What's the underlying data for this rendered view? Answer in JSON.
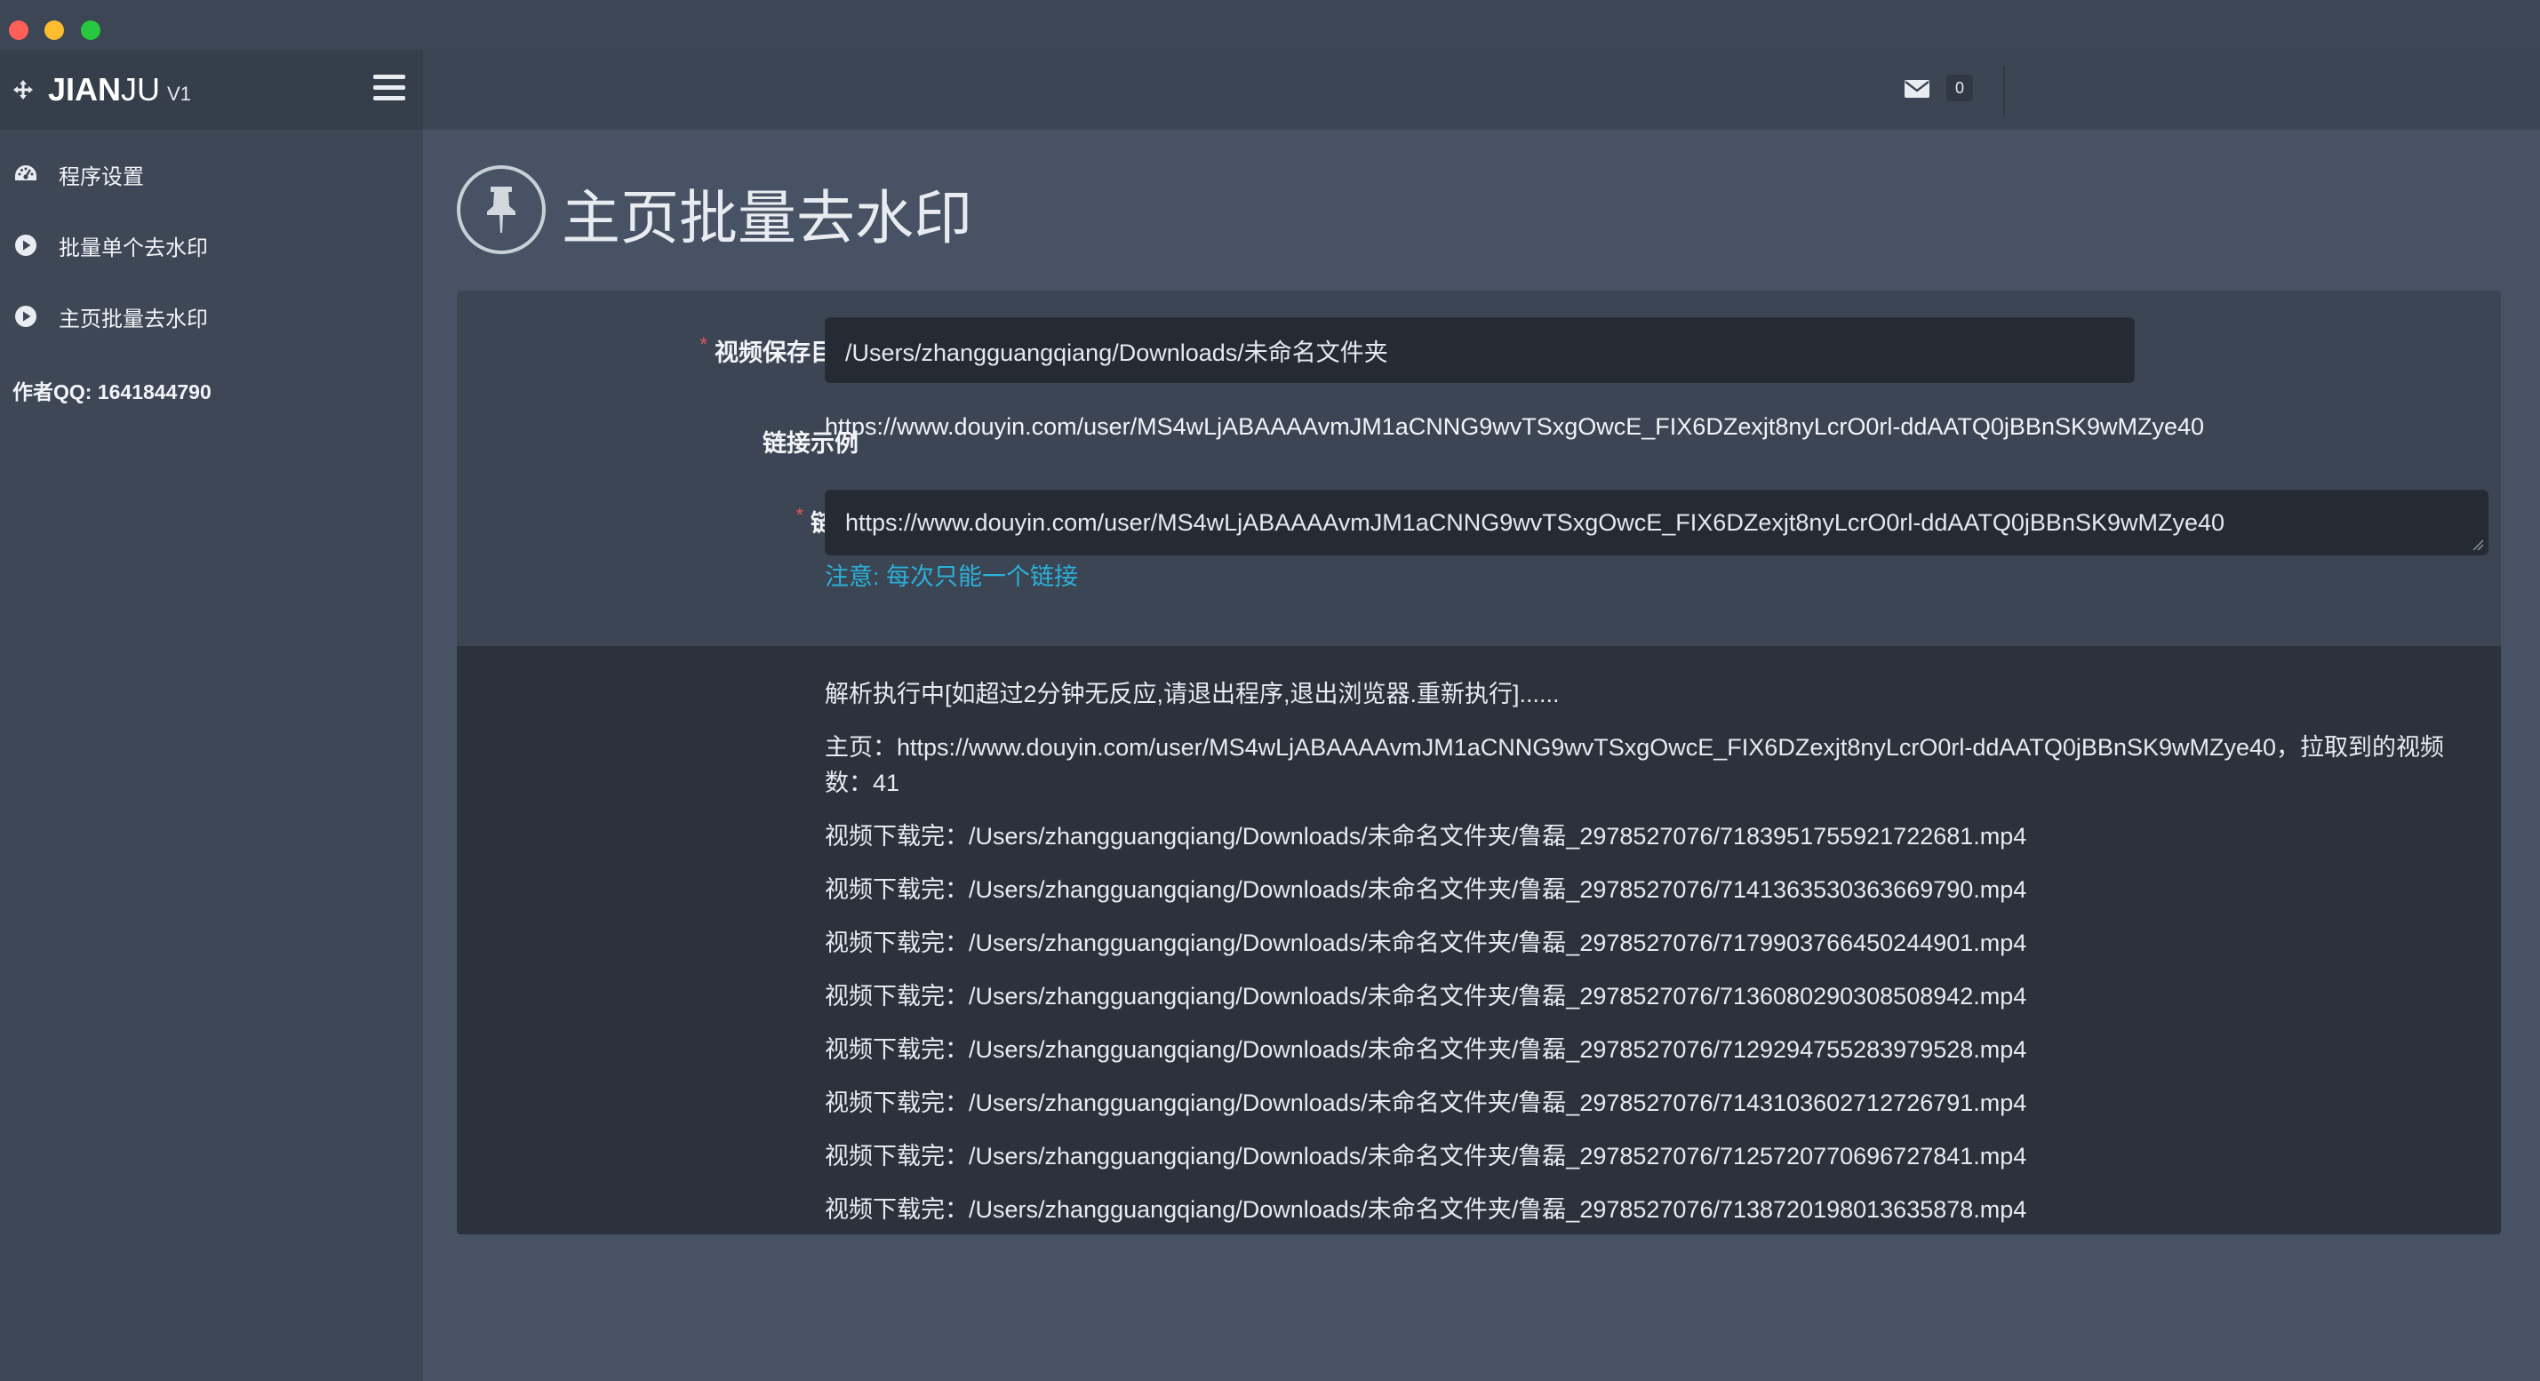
{
  "window": {
    "buttons": [
      "close",
      "minimize",
      "maximize"
    ]
  },
  "brand": {
    "name_bold": "JIAN",
    "name_light": "JU",
    "version": "V1",
    "icon": "arrows-icon"
  },
  "sidebar": {
    "items": [
      {
        "label": "程序设置",
        "icon": "dashboard-icon"
      },
      {
        "label": "批量单个去水印",
        "icon": "play-circle-icon"
      },
      {
        "label": "主页批量去水印",
        "icon": "play-circle-icon"
      }
    ],
    "author": "作者QQ: 1641844790"
  },
  "topbar": {
    "mail_count": "0"
  },
  "page": {
    "title": "主页批量去水印",
    "icon": "pushpin-icon"
  },
  "form": {
    "save_dir_label": "视频保存目录",
    "save_dir_value": "/Users/zhangguangqiang/Downloads/未命名文件夹",
    "example_label": "链接示例",
    "example_value": "https://www.douyin.com/user/MS4wLjABAAAAvmJM1aCNNG9wvTSxgOwcE_FIX6DZexjt8nyLcrO0rl-ddAATQ0jBBnSK9wMZye40",
    "link_label": "链接",
    "link_value": "https://www.douyin.com/user/MS4wLjABAAAAvmJM1aCNNG9wvTSxgOwcE_FIX6DZexjt8nyLcrO0rl-ddAATQ0jBBnSK9wMZye40",
    "hint": "注意: 每次只能一个链接"
  },
  "log": {
    "status": "解析执行中[如超过2分钟无反应,请退出程序,退出浏览器.重新执行]......",
    "summary": "主页：https://www.douyin.com/user/MS4wLjABAAAAvmJM1aCNNG9wvTSxgOwcE_FIX6DZexjt8nyLcrO0rl-ddAATQ0jBBnSK9wMZye40，拉取到的视频数：41",
    "downloads": [
      "视频下载完：/Users/zhangguangqiang/Downloads/未命名文件夹/鲁磊_2978527076/7183951755921722681.mp4",
      "视频下载完：/Users/zhangguangqiang/Downloads/未命名文件夹/鲁磊_2978527076/7141363530363669790.mp4",
      "视频下载完：/Users/zhangguangqiang/Downloads/未命名文件夹/鲁磊_2978527076/7179903766450244901.mp4",
      "视频下载完：/Users/zhangguangqiang/Downloads/未命名文件夹/鲁磊_2978527076/7136080290308508942.mp4",
      "视频下载完：/Users/zhangguangqiang/Downloads/未命名文件夹/鲁磊_2978527076/7129294755283979528.mp4",
      "视频下载完：/Users/zhangguangqiang/Downloads/未命名文件夹/鲁磊_2978527076/7143103602712726791.mp4",
      "视频下载完：/Users/zhangguangqiang/Downloads/未命名文件夹/鲁磊_2978527076/7125720770696727841.mp4",
      "视频下载完：/Users/zhangguangqiang/Downloads/未命名文件夹/鲁磊_2978527076/7138720198013635878.mp4"
    ]
  },
  "colors": {
    "background": "#475364",
    "sidebar": "#3d4756",
    "panel": "#3b4553",
    "log_panel": "#2b323c",
    "input": "#252b33",
    "hint": "#2bb0d8",
    "required": "#e05757"
  }
}
